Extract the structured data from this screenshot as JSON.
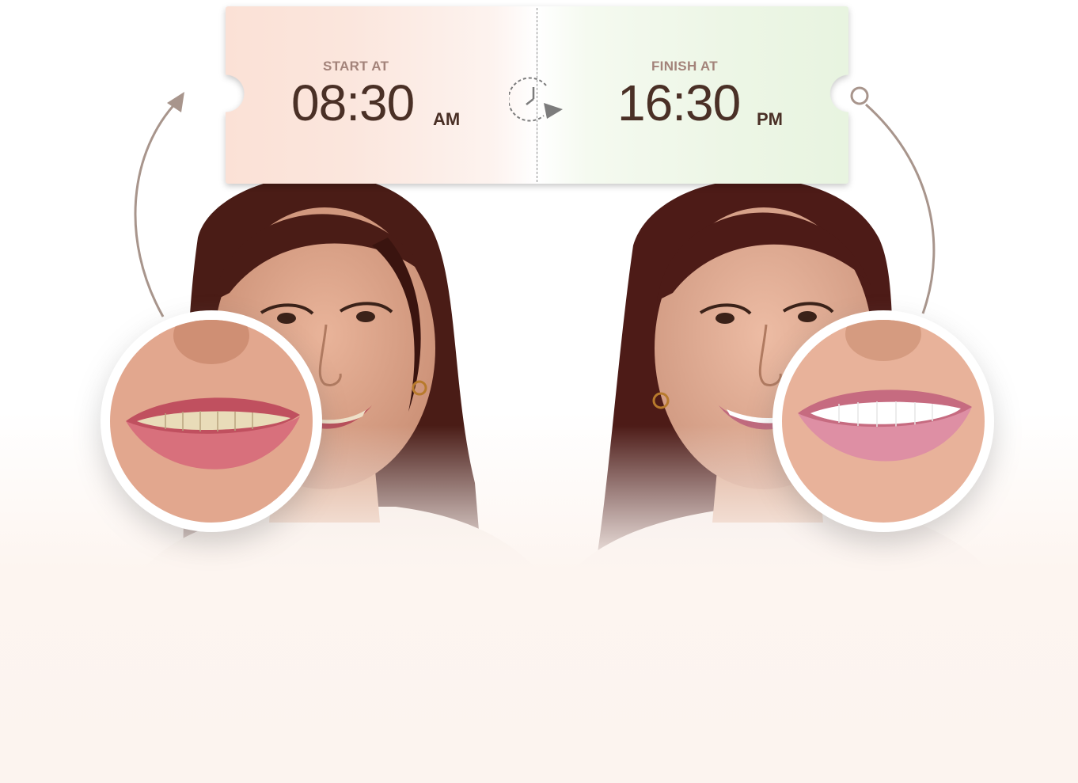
{
  "ticket": {
    "start_label": "START AT",
    "start_time": "08:30",
    "start_period": "AM",
    "finish_label": "FINISH AT",
    "finish_time": "16:30",
    "finish_period": "PM"
  },
  "icons": {
    "clock": "clock-icon",
    "arrow_left": "curved-arrow-icon",
    "arrow_right": "curved-line-circle-icon"
  },
  "images": {
    "before_portrait": "woman-portrait-before",
    "after_portrait": "woman-portrait-after",
    "before_zoom": "smile-closeup-before",
    "after_zoom": "smile-closeup-after"
  },
  "colors": {
    "label": "#a3837a",
    "time_text": "#4a3026",
    "arc": "#a8958c",
    "ticket_left": "#fbe1d6",
    "ticket_right": "#e8f4e0"
  }
}
